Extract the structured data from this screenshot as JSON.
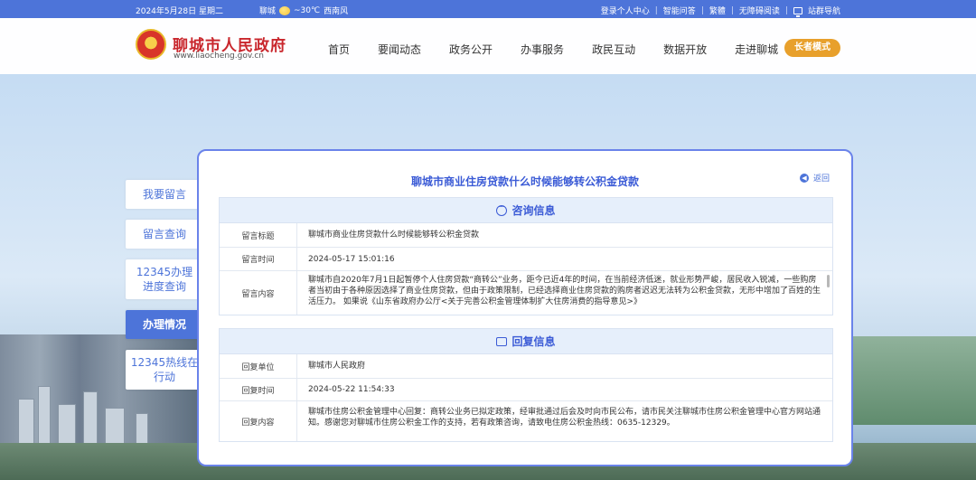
{
  "topbar": {
    "date": "2024年5月28日 星期二",
    "weather_city": "聊城",
    "temperature": "~30℃",
    "air": "西南风",
    "links": [
      "登录个人中心",
      "智能问答",
      "繁體",
      "无障碍阅读",
      "站群导航"
    ]
  },
  "header": {
    "site_name": "聊城市人民政府",
    "site_url": "www.liaocheng.gov.cn",
    "nav": [
      "首页",
      "要闻动态",
      "政务公开",
      "办事服务",
      "政民互动",
      "数据开放",
      "走进聊城"
    ],
    "elder_button": "长者模式"
  },
  "sidebar": {
    "items": [
      "我要留言",
      "留言查询",
      "12345办理进度查询",
      "办理情况",
      "12345热线在行动"
    ]
  },
  "panel": {
    "title": "聊城市商业住房贷款什么时候能够转公积金贷款",
    "back": "返回",
    "consult": {
      "heading": "咨询信息",
      "rows": [
        {
          "label": "留言标题",
          "value": "聊城市商业住房贷款什么时候能够转公积金贷款"
        },
        {
          "label": "留言时间",
          "value": "2024-05-17 15:01:16"
        },
        {
          "label": "留言内容",
          "value": "聊城市自2020年7月1日起暂停个人住房贷款“商转公”业务，距今已近4年的时间，在当前经济低迷，就业形势严峻，居民收入锐减，一些购房者当初由于各种原因选择了商业住房贷款，但由于政策限制，已经选择商业住房贷款的购房者迟迟无法转为公积金贷款，无形中增加了百姓的生活压力。 如果说《山东省政府办公厅<关于完善公积金管理体制扩大住房消费的指导意见>》"
        }
      ]
    },
    "reply": {
      "heading": "回复信息",
      "rows": [
        {
          "label": "回复单位",
          "value": "聊城市人民政府"
        },
        {
          "label": "回复时间",
          "value": "2024-05-22 11:54:33"
        },
        {
          "label": "回复内容",
          "value": "聊城市住房公积金管理中心回复：商转公业务已拟定政策，经审批通过后会及时向市民公布，请市民关注聊城市住房公积金管理中心官方网站通知。感谢您对聊城市住房公积金工作的支持，若有政策咨询，请致电住房公积金热线：0635-12329。"
        }
      ]
    }
  },
  "colors": {
    "primary": "#4d74d9",
    "brand_red": "#c9272d",
    "elder_orange": "#e8a02c",
    "panel_border": "#6a83ea"
  }
}
